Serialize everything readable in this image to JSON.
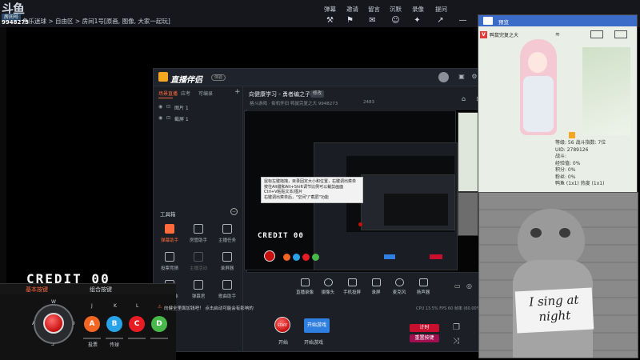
{
  "topbar": {
    "logo": "斗鱼",
    "room_badge": "房间号",
    "room_id": "9948273",
    "breadcrumb": "鱼乐迷球 > 自由区 > 房间1号[原画, 图像, 大家一起玩]",
    "menu": [
      "弹幕",
      "邀请",
      "留言",
      "沉默",
      "录像",
      "提问"
    ]
  },
  "app": {
    "title": "直播伴侣",
    "version": "体验",
    "scene_tabs": [
      "场景直播",
      "应考",
      "可编录"
    ],
    "sources": [
      "图片 1",
      "截屏 1"
    ],
    "tools_title": "工具箱",
    "tools": [
      {
        "label": "弹幕助手",
        "hot": true
      },
      {
        "label": "房管助手",
        "hot": false
      },
      {
        "label": "主播任务",
        "hot": false
      },
      {
        "label": "投票竞猜",
        "hot": false
      },
      {
        "label": "主播活动",
        "hot": false
      },
      {
        "label": "录屏器",
        "hot": false
      },
      {
        "label": "虚拟形象",
        "hot": false
      },
      {
        "label": "弹幕君",
        "hot": false
      },
      {
        "label": "歌曲助手",
        "hot": false
      }
    ],
    "room_title": "向健康学习 - 勇者编之子!",
    "room_title_tag": "修改",
    "room_sub": "格斗游戏 · 街机怀旧  鸭鼠完复之大  9948273",
    "viewer_count": "2483",
    "bottom_tools": [
      "直播录像",
      "摄像头",
      "手机投屏",
      "录屏",
      "麦克风",
      "扬声器"
    ],
    "status": "CPU 13.5%  FPS 60  帧率 (60.00%)"
  },
  "tooltip": {
    "lines": [
      "鼠标左键拖拽，目录固定大小和位置，右键调出菜单",
      "按住Alt键和Alt+Shift调节比例可以裁剪画面",
      "Ctrl+V粘贴文本/图片",
      "右键调出菜单后，\"空间\"/\"截屏\"功能"
    ]
  },
  "credit": "CREDIT  00",
  "pad": {
    "tabs": [
      "基本按键",
      "组合按键"
    ],
    "directions": [
      "W",
      "A",
      "S",
      "D"
    ],
    "buttons": [
      {
        "key": "J",
        "label": "A",
        "color": "#f26522"
      },
      {
        "key": "K",
        "label": "B",
        "color": "#29a3e8"
      },
      {
        "key": "L",
        "label": "C",
        "color": "#e81c24"
      },
      {
        "key": "",
        "label": "D",
        "color": "#48b84a"
      }
    ],
    "captions": [
      "投票",
      "传球"
    ]
  },
  "start": {
    "notice": "向健全里面加钱吧！ 点击启动可能会有影响的",
    "ball_label": "START",
    "start_caption": "开始",
    "start_game_label": "开始游戏",
    "start_game_caption": "开始游戏"
  },
  "side_buttons": [
    "计时",
    "重置按键"
  ],
  "anime": {
    "header_title": "预览",
    "name": "鸭鼠完复之大",
    "stats": [
      "等级: 56  战斗指数: 7位",
      "UID: 2789126",
      "战斗:",
      "经验值: 0%",
      "积分: 0%",
      "粉丝: 0%",
      "鸭鱼 (1x1)  热度 (1x1)"
    ]
  },
  "cat": {
    "sign": "I sing at night"
  }
}
